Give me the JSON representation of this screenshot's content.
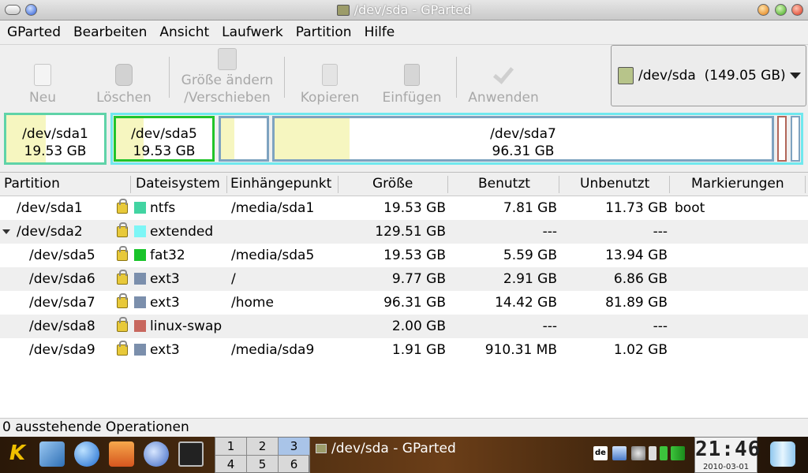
{
  "window": {
    "title": "/dev/sda - GParted"
  },
  "menu": [
    "GParted",
    "Bearbeiten",
    "Ansicht",
    "Laufwerk",
    "Partition",
    "Hilfe"
  ],
  "toolbar": {
    "new": "Neu",
    "delete": "Löschen",
    "resize_line1": "Größe ändern",
    "resize_line2": "/Verschieben",
    "copy": "Kopieren",
    "paste": "Einfügen",
    "apply": "Anwenden"
  },
  "device_selector": {
    "value": "/dev/sda  (149.05 GB)"
  },
  "partition_map": [
    {
      "name": "/dev/sda1",
      "size": "19.53 GB",
      "used_fraction": 0.4,
      "color": "#5fd3a8"
    },
    {
      "name": "/dev/sda5",
      "size": "19.53 GB",
      "used_fraction": 0.29,
      "color": "#21c42a"
    },
    {
      "name": "",
      "size": "",
      "used_fraction": 0.3,
      "color": "#7ea3c0"
    },
    {
      "name": "/dev/sda7",
      "size": "96.31 GB",
      "used_fraction": 0.15,
      "color": "#7ea3c0"
    }
  ],
  "table": {
    "headers": [
      "Partition",
      "Dateisystem",
      "Einhängepunkt",
      "Größe",
      "Benutzt",
      "Unbenutzt",
      "Markierungen"
    ],
    "rows": [
      {
        "partition": "/dev/sda1",
        "fs": "ntfs",
        "fs_color": "#42d4a2",
        "mount": "/media/sda1",
        "size": "19.53 GB",
        "used": "7.81 GB",
        "unused": "11.73 GB",
        "flags": "boot",
        "indent": 1,
        "expander": false
      },
      {
        "partition": "/dev/sda2",
        "fs": "extended",
        "fs_color": "#7df6f6",
        "mount": "",
        "size": "129.51 GB",
        "used": "---",
        "unused": "---",
        "flags": "",
        "indent": 1,
        "expander": true
      },
      {
        "partition": "/dev/sda5",
        "fs": "fat32",
        "fs_color": "#19c42a",
        "mount": "/media/sda5",
        "size": "19.53 GB",
        "used": "5.59 GB",
        "unused": "13.94 GB",
        "flags": "",
        "indent": 2,
        "expander": false
      },
      {
        "partition": "/dev/sda6",
        "fs": "ext3",
        "fs_color": "#7b8fac",
        "mount": "/",
        "size": "9.77 GB",
        "used": "2.91 GB",
        "unused": "6.86 GB",
        "flags": "",
        "indent": 2,
        "expander": false
      },
      {
        "partition": "/dev/sda7",
        "fs": "ext3",
        "fs_color": "#7b8fac",
        "mount": "/home",
        "size": "96.31 GB",
        "used": "14.42 GB",
        "unused": "81.89 GB",
        "flags": "",
        "indent": 2,
        "expander": false
      },
      {
        "partition": "/dev/sda8",
        "fs": "linux-swap",
        "fs_color": "#c8675e",
        "mount": "",
        "size": "2.00 GB",
        "used": "---",
        "unused": "---",
        "flags": "",
        "indent": 2,
        "expander": false
      },
      {
        "partition": "/dev/sda9",
        "fs": "ext3",
        "fs_color": "#7b8fac",
        "mount": "/media/sda9",
        "size": "1.91 GB",
        "used": "910.31 MB",
        "unused": "1.02 GB",
        "flags": "",
        "indent": 2,
        "expander": false
      }
    ]
  },
  "status": {
    "text": "0 ausstehende Operationen"
  },
  "taskbar": {
    "pager": [
      "1",
      "2",
      "3",
      "4",
      "5",
      "6"
    ],
    "active_desktop": "3",
    "task_title": "/dev/sda - GParted",
    "tray_lang": "de",
    "clock_time": "21:46",
    "clock_date": "2010-03-01"
  }
}
